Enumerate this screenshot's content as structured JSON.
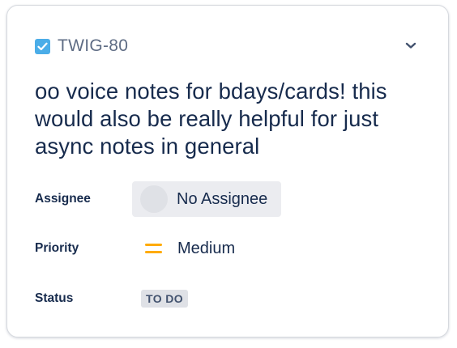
{
  "issue": {
    "key": "TWIG-80",
    "type_icon": "checkbox-icon",
    "type_color": "#4bade8",
    "summary": "oo voice notes for bdays/cards! this would also be really helpful for just async notes in general"
  },
  "header": {
    "collapse_icon": "chevron-down-icon"
  },
  "fields": {
    "assignee": {
      "label": "Assignee",
      "value": "No Assignee",
      "avatar_icon": "avatar-placeholder-icon"
    },
    "priority": {
      "label": "Priority",
      "value": "Medium",
      "icon": "priority-medium-icon",
      "color": "#ffab00"
    },
    "status": {
      "label": "Status",
      "value": "TO DO"
    }
  },
  "colors": {
    "text_primary": "#172b4d",
    "text_secondary": "#5e6c84",
    "chip_background": "#ebecf0",
    "lozenge_background": "#dfe1e6"
  }
}
